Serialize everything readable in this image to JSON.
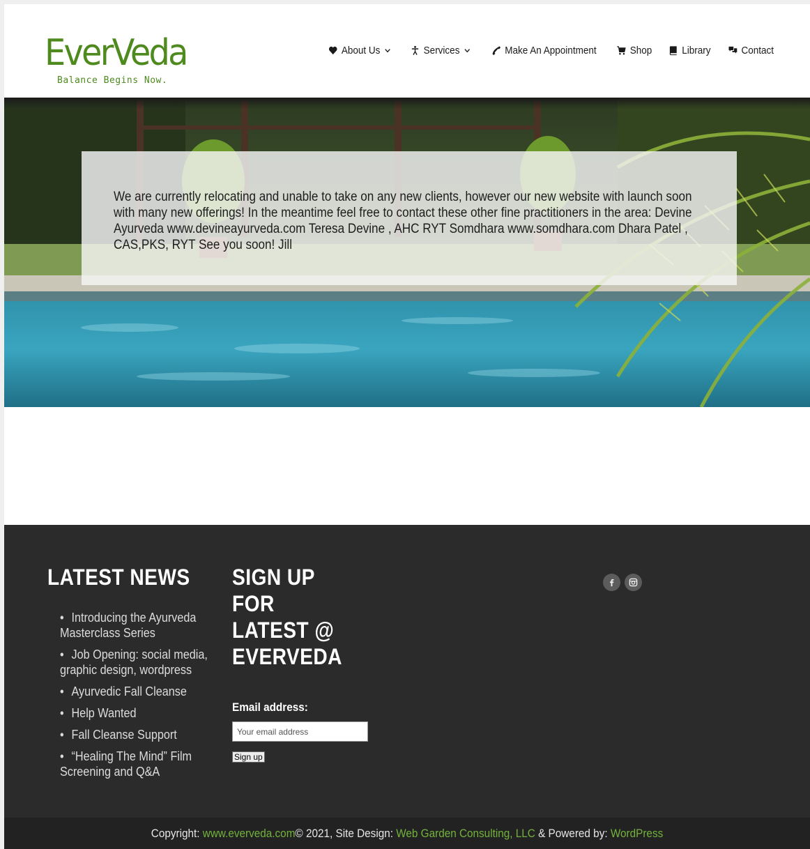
{
  "brand": {
    "name": "EverVeda",
    "tagline": "Balance Begins Now.",
    "color": "#4e8a1e"
  },
  "nav": {
    "items": [
      {
        "label": "About Us",
        "icon": "heart-icon",
        "dropdown": true
      },
      {
        "label": "Services",
        "icon": "person-icon",
        "dropdown": true
      },
      {
        "label": "Make An Appointment",
        "icon": "phone-icon",
        "dropdown": false
      },
      {
        "label": "Shop",
        "icon": "cart-icon",
        "dropdown": false
      },
      {
        "label": "Library",
        "icon": "book-icon",
        "dropdown": false
      },
      {
        "label": "Contact",
        "icon": "chat-icon",
        "dropdown": false
      }
    ]
  },
  "hero": {
    "notice": "We are currently relocating and unable to take on any new clients, however our new website with launch soon with many new offerings! In the meantime feel free to contact these other fine practitioners in the area: Devine Ayurveda www.devineayurveda.com Teresa Devine , AHC RYT Somdhara www.somdhara.com Dhara Patel , CAS,PKS, RYT See you soon! Jill"
  },
  "footer": {
    "news": {
      "title": "LATEST NEWS",
      "items": [
        "Introducing the Ayurveda Masterclass Series",
        "Job Opening: social media, graphic design, wordpress",
        "Ayurvedic Fall Cleanse",
        "Help Wanted",
        "Fall Cleanse Support",
        "“Healing The Mind” Film Screening and Q&A"
      ]
    },
    "signup": {
      "title": "SIGN UP FOR LATEST @ EVERVEDA",
      "email_label": "Email address:",
      "email_placeholder": "Your email address",
      "button_label": "Sign up"
    },
    "social": [
      {
        "name": "facebook-icon"
      },
      {
        "name": "instagram-icon"
      }
    ],
    "copyright": {
      "prefix": "Copyright: ",
      "site_link": "www.everveda.com",
      "middle": "© 2021, Site Design: ",
      "design_link": "Web Garden Consulting, LLC",
      "powered": " & Powered by: ",
      "powered_link": "WordPress",
      "link_color": "#73b33c"
    }
  }
}
